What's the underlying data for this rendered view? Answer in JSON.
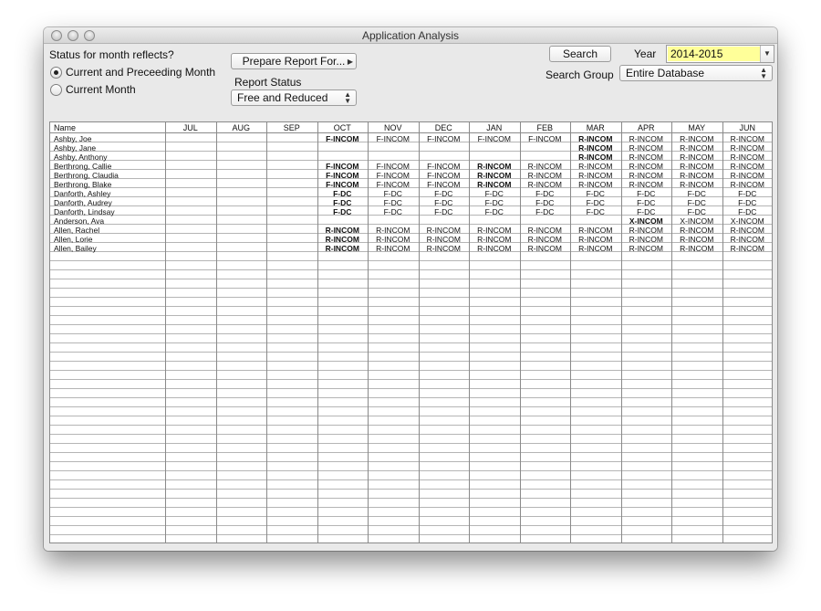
{
  "window": {
    "title": "Application Analysis"
  },
  "status_section": {
    "heading": "Status for month reflects?",
    "options": [
      {
        "label": "Current and Preceeding Month",
        "selected": true
      },
      {
        "label": "Current Month",
        "selected": false
      }
    ]
  },
  "prepare_button": {
    "label": "Prepare Report For..."
  },
  "report_status": {
    "label": "Report Status",
    "value": "Free and Reduced"
  },
  "search_button": {
    "label": "Search"
  },
  "year": {
    "label": "Year",
    "value": "2014-2015"
  },
  "search_group": {
    "label": "Search Group",
    "value": "Entire Database"
  },
  "table": {
    "columns": [
      "Name",
      "JUL",
      "AUG",
      "SEP",
      "OCT",
      "NOV",
      "DEC",
      "JAN",
      "FEB",
      "MAR",
      "APR",
      "MAY",
      "JUN"
    ],
    "rows": [
      {
        "name": "Ashby, Joe",
        "months": [
          "",
          "",
          "",
          "F-INCOM",
          "F-INCOM",
          "F-INCOM",
          "F-INCOM",
          "F-INCOM",
          "R-INCOM",
          "R-INCOM",
          "R-INCOM",
          "R-INCOM"
        ],
        "bold": [
          3,
          8
        ]
      },
      {
        "name": "Ashby, Jane",
        "months": [
          "",
          "",
          "",
          "",
          "",
          "",
          "",
          "",
          "R-INCOM",
          "R-INCOM",
          "R-INCOM",
          "R-INCOM"
        ],
        "bold": [
          8
        ]
      },
      {
        "name": "Ashby, Anthony",
        "months": [
          "",
          "",
          "",
          "",
          "",
          "",
          "",
          "",
          "R-INCOM",
          "R-INCOM",
          "R-INCOM",
          "R-INCOM"
        ],
        "bold": [
          8
        ]
      },
      {
        "name": "Berthrong, Callie",
        "months": [
          "",
          "",
          "",
          "F-INCOM",
          "F-INCOM",
          "F-INCOM",
          "R-INCOM",
          "R-INCOM",
          "R-INCOM",
          "R-INCOM",
          "R-INCOM",
          "R-INCOM"
        ],
        "bold": [
          3,
          6
        ]
      },
      {
        "name": "Berthrong, Claudia",
        "months": [
          "",
          "",
          "",
          "F-INCOM",
          "F-INCOM",
          "F-INCOM",
          "R-INCOM",
          "R-INCOM",
          "R-INCOM",
          "R-INCOM",
          "R-INCOM",
          "R-INCOM"
        ],
        "bold": [
          3,
          6
        ]
      },
      {
        "name": "Berthrong, Blake",
        "months": [
          "",
          "",
          "",
          "F-INCOM",
          "F-INCOM",
          "F-INCOM",
          "R-INCOM",
          "R-INCOM",
          "R-INCOM",
          "R-INCOM",
          "R-INCOM",
          "R-INCOM"
        ],
        "bold": [
          3,
          6
        ]
      },
      {
        "name": "Danforth, Ashley",
        "months": [
          "",
          "",
          "",
          "F-DC",
          "F-DC",
          "F-DC",
          "F-DC",
          "F-DC",
          "F-DC",
          "F-DC",
          "F-DC",
          "F-DC"
        ],
        "bold": [
          3
        ]
      },
      {
        "name": "Danforth, Audrey",
        "months": [
          "",
          "",
          "",
          "F-DC",
          "F-DC",
          "F-DC",
          "F-DC",
          "F-DC",
          "F-DC",
          "F-DC",
          "F-DC",
          "F-DC"
        ],
        "bold": [
          3
        ]
      },
      {
        "name": "Danforth, Lindsay",
        "months": [
          "",
          "",
          "",
          "F-DC",
          "F-DC",
          "F-DC",
          "F-DC",
          "F-DC",
          "F-DC",
          "F-DC",
          "F-DC",
          "F-DC"
        ],
        "bold": [
          3
        ]
      },
      {
        "name": "Anderson, Ava",
        "months": [
          "",
          "",
          "",
          "",
          "",
          "",
          "",
          "",
          "",
          "X-INCOM",
          "X-INCOM",
          "X-INCOM"
        ],
        "bold": [
          9
        ]
      },
      {
        "name": "Allen, Rachel",
        "months": [
          "",
          "",
          "",
          "R-INCOM",
          "R-INCOM",
          "R-INCOM",
          "R-INCOM",
          "R-INCOM",
          "R-INCOM",
          "R-INCOM",
          "R-INCOM",
          "R-INCOM"
        ],
        "bold": [
          3
        ]
      },
      {
        "name": "Allen, Lorie",
        "months": [
          "",
          "",
          "",
          "R-INCOM",
          "R-INCOM",
          "R-INCOM",
          "R-INCOM",
          "R-INCOM",
          "R-INCOM",
          "R-INCOM",
          "R-INCOM",
          "R-INCOM"
        ],
        "bold": [
          3
        ]
      },
      {
        "name": "Allen, Bailey",
        "months": [
          "",
          "",
          "",
          "R-INCOM",
          "R-INCOM",
          "R-INCOM",
          "R-INCOM",
          "R-INCOM",
          "R-INCOM",
          "R-INCOM",
          "R-INCOM",
          "R-INCOM"
        ],
        "bold": [
          3
        ]
      }
    ]
  }
}
